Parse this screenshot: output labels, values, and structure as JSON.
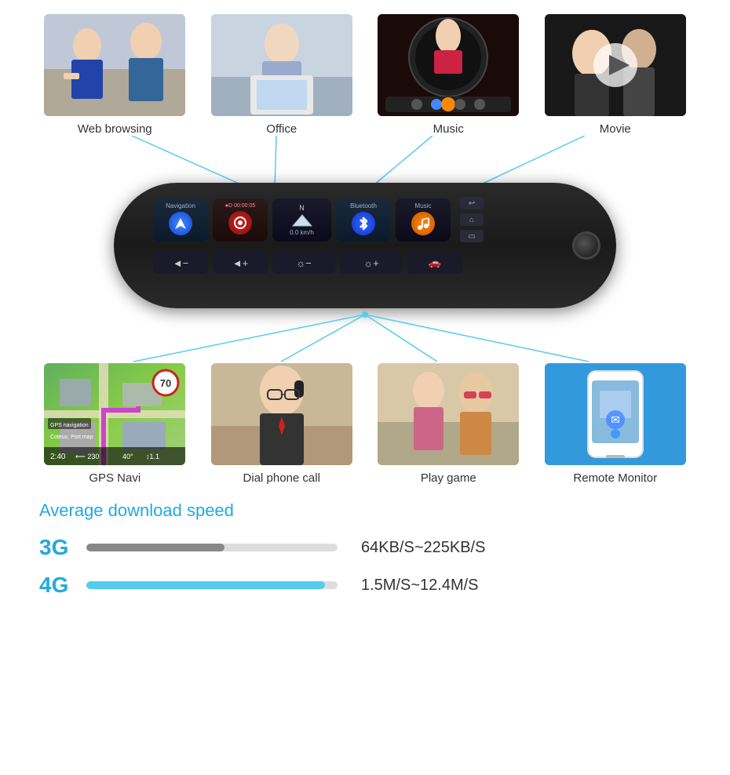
{
  "top_features": [
    {
      "label": "Web browsing",
      "img_class": "img-web"
    },
    {
      "label": "Office",
      "img_class": "img-office"
    },
    {
      "label": "Music",
      "img_class": "img-music"
    },
    {
      "label": "Movie",
      "img_class": "img-movie"
    }
  ],
  "device": {
    "nav_label": "Navigation",
    "dash_label": "●D 00:00:05",
    "speed_label": "0.0 km/h",
    "bluetooth_label": "Bluetooth",
    "music_label": "Music"
  },
  "bottom_features": [
    {
      "label": "GPS Navi",
      "img_class": "img-gps"
    },
    {
      "label": "Dial phone call",
      "img_class": "img-phone"
    },
    {
      "label": "Play game",
      "img_class": "img-game"
    },
    {
      "label": "Remote Monitor",
      "img_class": "img-remote"
    }
  ],
  "speed_section": {
    "title": "Average download speed",
    "rows": [
      {
        "label": "3G",
        "fill_pct": 55,
        "value": "64KB/S~225KB/S"
      },
      {
        "label": "4G",
        "fill_pct": 95,
        "value": "1.5M/S~12.4M/S"
      }
    ]
  }
}
